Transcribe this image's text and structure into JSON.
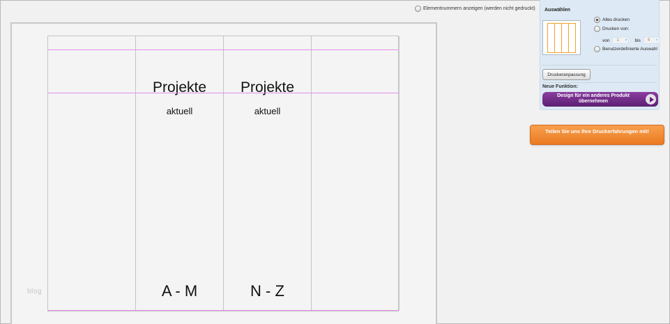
{
  "top_option": {
    "label": "Elementnummern anzeigen (werden nicht gedruckt)"
  },
  "preview": {
    "panels": [
      {
        "title": "",
        "subtitle": "",
        "range": ""
      },
      {
        "title": "Projekte",
        "subtitle": "aktuell",
        "range": "A - M"
      },
      {
        "title": "Projekte",
        "subtitle": "aktuell",
        "range": "N - Z"
      },
      {
        "title": "",
        "subtitle": "",
        "range": ""
      }
    ],
    "watermark": "blog",
    "guide_color": "#e58be8"
  },
  "print_panel": {
    "title": "Auswählen",
    "options": {
      "all": "Alles drucken",
      "from": "Drucken von:",
      "custom": "Benutzerdefinierte Auswahl"
    },
    "selected": "all",
    "range": {
      "from_label": "von",
      "from_value": "1",
      "to_label": "bis",
      "to_value": "4"
    },
    "adjust_button": "Druckeranpassung",
    "new_feature_label": "Neue Funktion:",
    "design_button": "Design für ein anderes Produkt übernehmen",
    "accent_color": "#6e2a87"
  },
  "feedback_button": {
    "label": "Teilen Sie uns Ihre Druckerfahrungen mit!",
    "color": "#f08a33"
  }
}
